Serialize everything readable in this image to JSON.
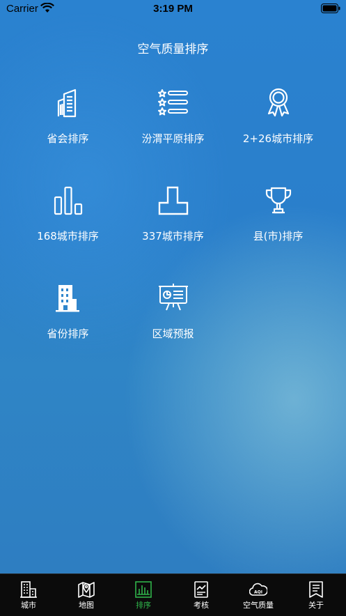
{
  "status_bar": {
    "carrier": "Carrier",
    "time": "3:19 PM"
  },
  "page": {
    "title": "空气质量排序"
  },
  "grid_items": [
    {
      "label": "省会排序",
      "icon": "buildings-icon"
    },
    {
      "label": "汾渭平原排序",
      "icon": "star-list-icon"
    },
    {
      "label": "2+26城市排序",
      "icon": "award-ribbon-icon"
    },
    {
      "label": "168城市排序",
      "icon": "bar-chart-icon"
    },
    {
      "label": "337城市排序",
      "icon": "step-blocks-icon"
    },
    {
      "label": "县(市)排序",
      "icon": "trophy-icon"
    },
    {
      "label": "省份排序",
      "icon": "office-building-icon"
    },
    {
      "label": "区域预报",
      "icon": "presentation-board-icon"
    }
  ],
  "tabs": [
    {
      "label": "城市",
      "icon": "city-building-icon",
      "active": false
    },
    {
      "label": "地图",
      "icon": "map-pin-icon",
      "active": false
    },
    {
      "label": "排序",
      "icon": "bar-chart-icon",
      "active": true
    },
    {
      "label": "考核",
      "icon": "report-chart-icon",
      "active": false
    },
    {
      "label": "空气质量",
      "icon": "aqi-cloud-icon",
      "active": false
    },
    {
      "label": "关于",
      "icon": "document-icon",
      "active": false
    }
  ],
  "colors": {
    "active_tab": "#2fb34a",
    "tab_bar_bg": "#0b0b0b",
    "icon_stroke": "#ffffff"
  },
  "tab_aqi_text": "AQI"
}
